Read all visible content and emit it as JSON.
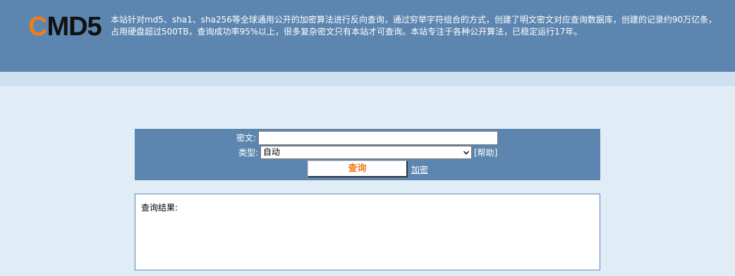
{
  "header": {
    "logo_first_letter": "C",
    "logo_rest": "MD5",
    "intro": "本站针对md5、sha1、sha256等全球通用公开的加密算法进行反向查询，通过穷举字符组合的方式，创建了明文密文对应查询数据库，创建的记录约90万亿条，占用硬盘超过500TB，查询成功率95%以上，很多复杂密文只有本站才可查询。本站专注于各种公开算法，已稳定运行17年。"
  },
  "form": {
    "cipher_label": "密文:",
    "cipher_value": "",
    "type_label": "类型:",
    "type_selected": "自动",
    "help_link": "[帮助]",
    "query_button": "查询",
    "encrypt_link": "加密"
  },
  "result": {
    "label": "查询结果:"
  },
  "colors": {
    "header_bg": "#5c86b0",
    "page_bg": "#e1edf6",
    "accent": "#f07d16"
  },
  "icons": {
    "select_arrow": "chevron-down-icon"
  }
}
